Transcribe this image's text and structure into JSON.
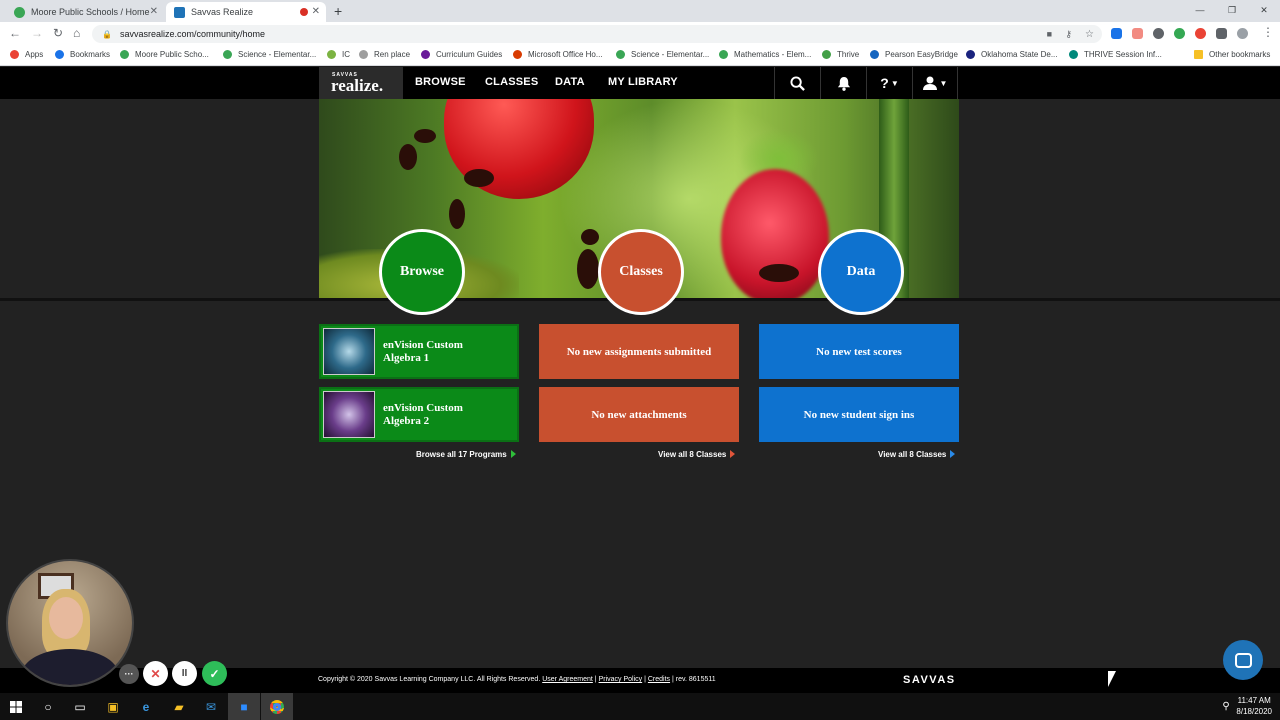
{
  "browser": {
    "tabs": [
      {
        "title": "Moore Public Schools / Home",
        "favicon_color": "#3aa655"
      },
      {
        "title": "Savvas Realize",
        "favicon_color": "#1f73b7"
      }
    ],
    "new_tab": "+",
    "url": "savvasrealize.com/community/home",
    "bookmarks": [
      {
        "label": "Apps",
        "color": "#ea4335"
      },
      {
        "label": "Bookmarks",
        "color": "#1a73e8"
      },
      {
        "label": "Moore Public Scho...",
        "color": "#3aa655"
      },
      {
        "label": "Science - Elementar...",
        "color": "#3aa655"
      },
      {
        "label": "IC",
        "color": "#7cb342"
      },
      {
        "label": "Ren place",
        "color": "#9e9e9e"
      },
      {
        "label": "Curriculum Guides",
        "color": "#6a1b9a"
      },
      {
        "label": "Microsoft Office Ho...",
        "color": "#d83b01"
      },
      {
        "label": "Science - Elementar...",
        "color": "#3aa655"
      },
      {
        "label": "Mathematics - Elem...",
        "color": "#3aa655"
      },
      {
        "label": "Thrive",
        "color": "#43a047"
      },
      {
        "label": "Pearson EasyBridge",
        "color": "#1565c0"
      },
      {
        "label": "Oklahoma State De...",
        "color": "#1a237e"
      },
      {
        "label": "THRIVE Session Inf...",
        "color": "#00897b"
      },
      {
        "label": "Other bookmarks",
        "color": "#f6c026"
      }
    ]
  },
  "app": {
    "logo_small": "SAVVAS",
    "logo_big": "realize.",
    "nav": [
      "BROWSE",
      "CLASSES",
      "DATA",
      "MY LIBRARY"
    ],
    "nav_icons": [
      "search-icon",
      "bell-icon",
      "help-icon",
      "user-icon"
    ],
    "help_glyph": "?",
    "hubs": [
      {
        "label": "Browse",
        "color": "#0b8a18"
      },
      {
        "label": "Classes",
        "color": "#c8502f"
      },
      {
        "label": "Data",
        "color": "#0e72cf"
      }
    ],
    "programs": [
      {
        "title": "enVision Custom Algebra 1"
      },
      {
        "title": "enVision Custom Algebra 2"
      }
    ],
    "classes_tiles": [
      "No new assignments submitted",
      "No new attachments"
    ],
    "data_tiles": [
      "No new test scores",
      "No new student sign ins"
    ],
    "browse_all": "Browse all 17 Programs",
    "view_classes": "View all 8 Classes",
    "view_data": "View all 8 Classes",
    "footer": {
      "copyright": "Copyright © 2020 Savvas Learning Company LLC. All Rights Reserved.",
      "user_agreement": "User Agreement",
      "privacy": "Privacy Policy",
      "credits": "Credits",
      "rev": "rev. 8615511",
      "sep": "|",
      "brand": "SAVVAS"
    }
  },
  "recorder": {
    "more": "···",
    "cancel": "✕",
    "pause": "II",
    "done": "✓"
  },
  "taskbar": {
    "time": "11:47 AM",
    "date": "8/18/2020"
  }
}
